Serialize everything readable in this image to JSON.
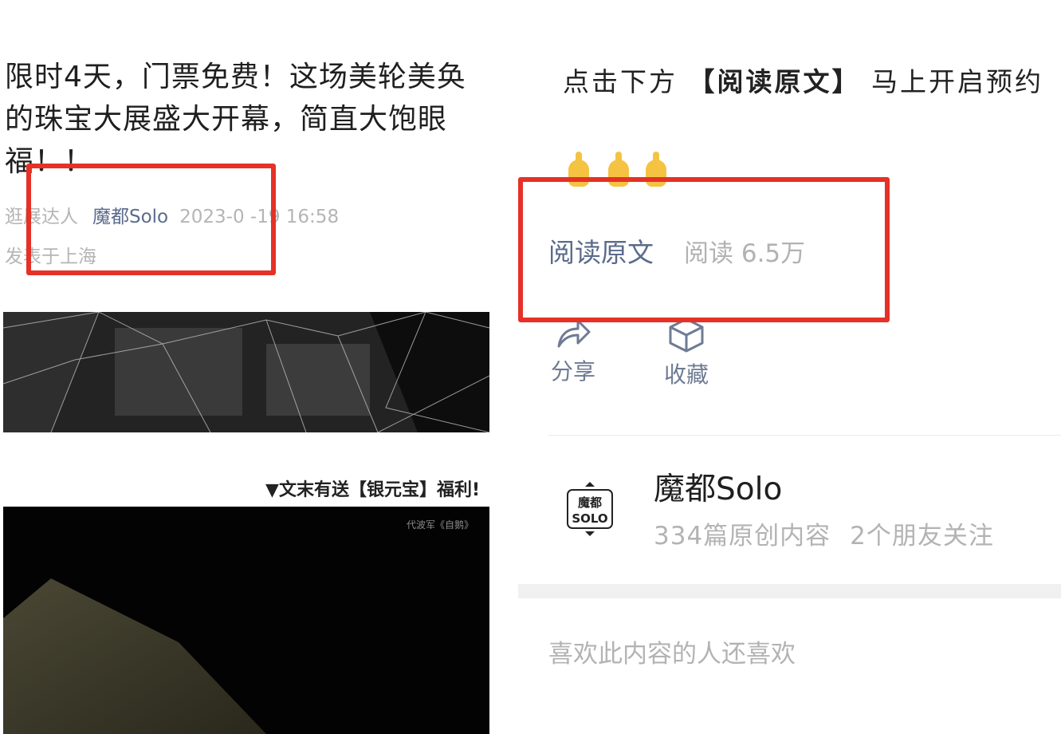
{
  "article": {
    "title": "限时4天，门票免费！这场美轮美奂的珠宝大展盛大开幕，简直大饱眼福！！",
    "meta": {
      "account_prefix": "逛展达人",
      "author": "魔都Solo",
      "datetime": "2023-0 -19 16:58",
      "location": "发表于上海"
    },
    "promo_line": "▼文末有送【银元宝】福利!",
    "video_caption": "代波军《自鹅》"
  },
  "right_panel": {
    "prompt": {
      "before": "点击下方",
      "highlight": "【阅读原文】",
      "after": "马上开启预约"
    },
    "read_original_label": "阅读原文",
    "read_count": "阅读 6.5万",
    "actions": {
      "share_label": "分享",
      "favorite_label": "收藏"
    },
    "account": {
      "name": "魔都Solo",
      "logo_top": "魔都",
      "logo_bottom": "SOLO",
      "original_count": "334篇原创内容",
      "friends_following": "2个朋友关注"
    },
    "recommend_header": "喜欢此内容的人还喜欢"
  },
  "colors": {
    "highlight_red": "#e53127",
    "link_blue_gray": "#5b6b8c",
    "muted_gray": "#b3b3b3",
    "emoji_yellow": "#f5c342"
  },
  "icons": [
    "share-icon",
    "favorite-box-icon",
    "pointing-hand-emoji"
  ]
}
